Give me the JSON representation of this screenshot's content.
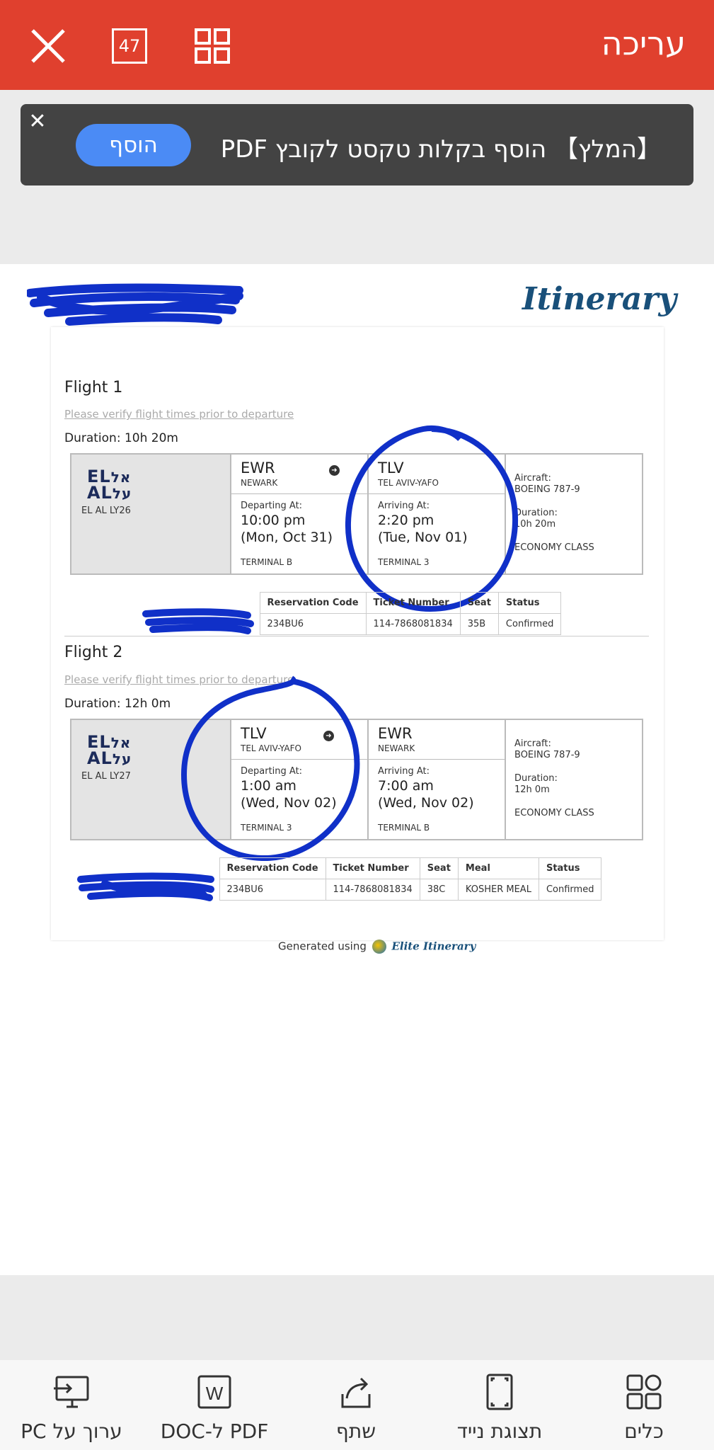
{
  "topbar": {
    "title": "עריכה",
    "page_count": "47"
  },
  "banner": {
    "text": "【המלץ】 הוסף בקלות טקסט לקובץ PDF",
    "button": "הוסף"
  },
  "document": {
    "title": "Itinerary",
    "flights": [
      {
        "heading": "Flight 1",
        "verify": "Please verify flight times prior to departure",
        "duration": "Duration: 10h 20m",
        "airline_code": "EL AL LY26",
        "from": {
          "code": "EWR",
          "city": "NEWARK",
          "label": "Departing At:",
          "time": "10:00 pm",
          "date": "(Mon, Oct 31)",
          "terminal": "TERMINAL B"
        },
        "to": {
          "code": "TLV",
          "city": "TEL AVIV-YAFO",
          "label": "Arriving At:",
          "time": "2:20 pm",
          "date": "(Tue, Nov 01)",
          "terminal": "TERMINAL 3"
        },
        "aircraft_label": "Aircraft:",
        "aircraft": "BOEING 787-9",
        "duration_label": "Duration:",
        "duration_value": "10h 20m",
        "class": "ECONOMY CLASS",
        "reservation": {
          "headers": [
            "Reservation Code",
            "Ticket Number",
            "Seat",
            "Status"
          ],
          "row": [
            "234BU6",
            "114-7868081834",
            "35B",
            "Confirmed"
          ]
        }
      },
      {
        "heading": "Flight 2",
        "verify": "Please verify flight times prior to departure",
        "duration": "Duration: 12h 0m",
        "airline_code": "EL AL LY27",
        "from": {
          "code": "TLV",
          "city": "TEL AVIV-YAFO",
          "label": "Departing At:",
          "time": "1:00 am",
          "date": "(Wed, Nov 02)",
          "terminal": "TERMINAL 3"
        },
        "to": {
          "code": "EWR",
          "city": "NEWARK",
          "label": "Arriving At:",
          "time": "7:00 am",
          "date": "(Wed, Nov 02)",
          "terminal": "TERMINAL B"
        },
        "aircraft_label": "Aircraft:",
        "aircraft": "BOEING 787-9",
        "duration_label": "Duration:",
        "duration_value": "12h 0m",
        "class": "ECONOMY CLASS",
        "reservation": {
          "headers": [
            "Reservation Code",
            "Ticket Number",
            "Seat",
            "Meal",
            "Status"
          ],
          "row": [
            "234BU6",
            "114-7868081834",
            "38C",
            "KOSHER MEAL",
            "Confirmed"
          ]
        }
      }
    ],
    "generated_prefix": "Generated using",
    "generated_brand": "Elite Itinerary"
  },
  "bottombar": {
    "tools": "כלים",
    "mobile_view": "תצוגת נייד",
    "share": "שתף",
    "pdf_to_doc": "PDF ל-DOC",
    "edit_on_pc": "ערוך על PC"
  },
  "colors": {
    "topbar": "#e0402e",
    "banner_button": "#4b8bf5",
    "scribble": "#1030c8"
  }
}
